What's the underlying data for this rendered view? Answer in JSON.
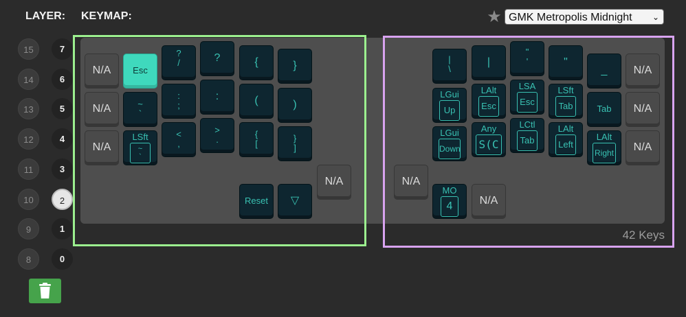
{
  "header": {
    "layer_label": "LAYER:",
    "keymap_label": "KEYMAP:",
    "keymap_select": {
      "value": "GMK Metropolis Midnight"
    },
    "star_icon": "star-icon"
  },
  "layers": {
    "left": [
      "15",
      "14",
      "13",
      "12",
      "11",
      "10",
      "9",
      "8"
    ],
    "right": [
      "7",
      "6",
      "5",
      "4",
      "3",
      "2",
      "1",
      "0"
    ],
    "selected": "2"
  },
  "delete_icon": "trash-icon",
  "key_count": "42 Keys",
  "colors": {
    "left_half_border": "#9cf08f",
    "right_half_border": "#d8a3f0",
    "keycap": "#0e2630",
    "legend": "#39c2b3",
    "active_key": "#3fd9bd",
    "delete_button": "#46a34b"
  },
  "keys": {
    "left": {
      "r0": [
        "N/A",
        "Esc",
        "?",
        "/",
        "?",
        "{",
        "}"
      ],
      "r1": [
        "N/A",
        "~",
        "`",
        ":",
        ";",
        ":",
        "(",
        ")"
      ],
      "r2": [
        "N/A",
        "LSft",
        "~",
        "`",
        "<",
        ",",
        ">",
        ".",
        "{",
        "[",
        "}",
        "]"
      ],
      "thumbs": [
        "Reset",
        "▽",
        "N/A"
      ]
    },
    "right": {
      "r0": [
        "|",
        "\\",
        "|",
        "\"",
        "'",
        "\"",
        "_",
        "N/A"
      ],
      "r1": [
        "LGui",
        "Up",
        "LAlt",
        "Esc",
        "LSA",
        "Esc",
        "LSft",
        "Tab",
        "Tab",
        "N/A"
      ],
      "r2": [
        "LGui",
        "Down",
        "Any",
        "S(C",
        "LCtl",
        "Tab",
        "LAlt",
        "Left",
        "LAlt",
        "Right",
        "N/A"
      ],
      "thumbs": [
        "N/A",
        "MO",
        "4",
        "N/A"
      ]
    }
  }
}
